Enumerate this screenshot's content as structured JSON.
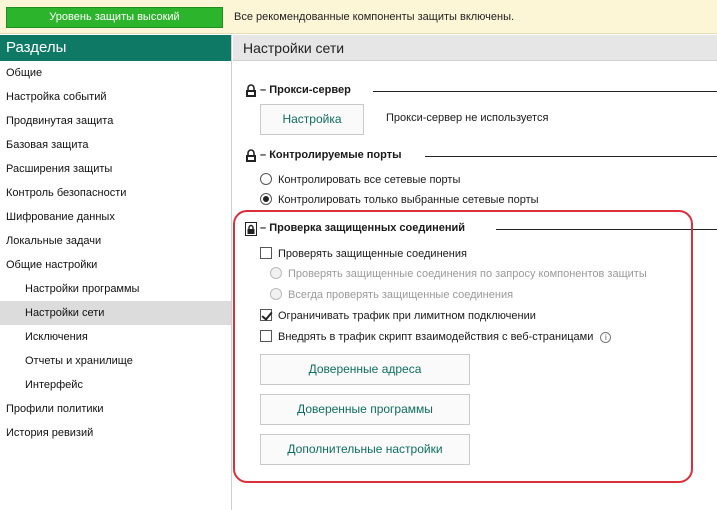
{
  "status": {
    "level_label": "Уровень защиты высокий",
    "message": "Все рекомендованные компоненты защиты включены.",
    "level_color": "#2cb52c"
  },
  "sidebar": {
    "header": "Разделы",
    "items": [
      {
        "label": "Общие"
      },
      {
        "label": "Настройка событий"
      },
      {
        "label": "Продвинутая защита"
      },
      {
        "label": "Базовая защита"
      },
      {
        "label": "Расширения защиты"
      },
      {
        "label": "Контроль безопасности"
      },
      {
        "label": "Шифрование данных"
      },
      {
        "label": "Локальные задачи"
      },
      {
        "label": "Общие настройки"
      },
      {
        "label": "Настройки программы"
      },
      {
        "label": "Настройки сети"
      },
      {
        "label": "Исключения"
      },
      {
        "label": "Отчеты и хранилище"
      },
      {
        "label": "Интерфейс"
      },
      {
        "label": "Профили политики"
      },
      {
        "label": "История ревизий"
      }
    ]
  },
  "main": {
    "title": "Настройки сети",
    "proxy": {
      "title": "Прокси-сервер",
      "button": "Настройка",
      "status": "Прокси-сервер не используется"
    },
    "ports": {
      "title": "Контролируемые порты",
      "options": [
        {
          "label": "Контролировать все сетевые порты",
          "checked": false
        },
        {
          "label": "Контролировать только выбранные сетевые порты",
          "checked": true
        }
      ]
    },
    "secure": {
      "title": "Проверка защищенных соединений",
      "check_secure": "Проверять защищенные соединения",
      "radio_on_request": "Проверять защищенные соединения по запросу компонентов защиты",
      "radio_always": "Всегда проверять защищенные соединения",
      "limit_traffic": "Ограничивать трафик при лимитном подключении",
      "inject_script": "Внедрять в трафик скрипт взаимодействия с веб-страницами",
      "info_icon_glyph": "i",
      "buttons": {
        "trusted_addresses": "Доверенные адреса",
        "trusted_programs": "Доверенные программы",
        "advanced": "Дополнительные настройки"
      }
    }
  },
  "colors": {
    "accent": "#0e7a66",
    "highlight": "#dc2f3a"
  }
}
